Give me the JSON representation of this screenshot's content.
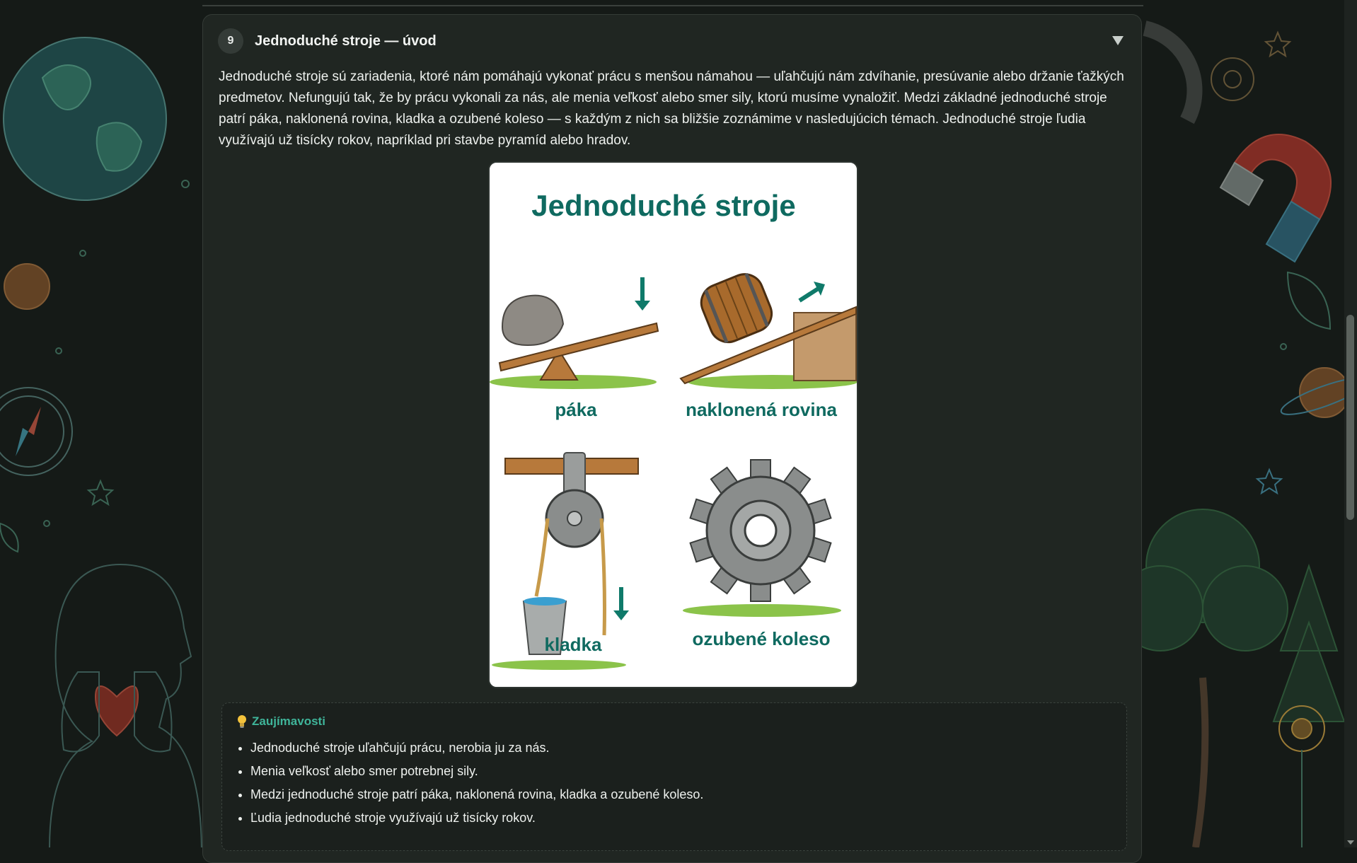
{
  "section": {
    "number": "9",
    "title": "Jednoduché stroje — úvod",
    "intro": "Jednoduché stroje sú zariadenia, ktoré nám pomáhajú vykonať prácu s menšou námahou — uľahčujú nám zdvíhanie, presúvanie alebo držanie ťažkých predmetov. Nefungujú tak, že by prácu vykonali za nás, ale menia veľkosť alebo smer sily, ktorú musíme vynaložiť. Medzi základné jednoduché stroje patrí páka, naklonená rovina, kladka a ozubené koleso — s každým z nich sa bližšie zoznámime v nasledujúcich témach. Jednoduché stroje ľudia využívajú už tisícky rokov, napríklad pri stavbe pyramíd alebo hradov."
  },
  "illustration": {
    "title": "Jednoduché stroje",
    "labels": [
      "páka",
      "naklonená rovina",
      "kladka",
      "ozubené koleso"
    ]
  },
  "facts": {
    "title": "Zaujímavosti",
    "items": [
      "Jednoduché stroje uľahčujú prácu, nerobia ju za nás.",
      "Menia veľkosť alebo smer potrebnej sily.",
      "Medzi jednoduché stroje patrí páka, naklonená rovina, kladka a ozubené koleso.",
      "Ľudia jednoduché stroje využívajú už tisícky rokov."
    ]
  },
  "colors": {
    "accent": "#3fb59a",
    "card_bg": "#202622",
    "page_bg": "#151a17",
    "figure_label": "#0f6a60"
  }
}
